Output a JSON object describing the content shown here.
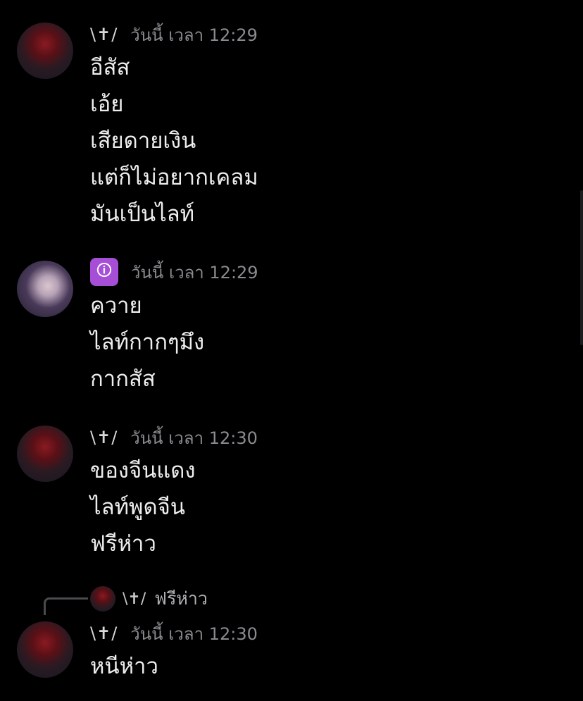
{
  "messages": [
    {
      "avatar": "red-masked-avatar",
      "name": "\\✝/",
      "timestamp": "วันนี้ เวลา 12:29",
      "lines": [
        "อีสัส",
        "เอ้ย",
        "เสียดายเงิน",
        "แต่ก็ไม่อยากเคลม",
        "มันเป็นไลท์"
      ]
    },
    {
      "avatar": "purple-hair-girl-avatar",
      "badge": "🛈",
      "timestamp": "วันนี้ เวลา 12:29",
      "lines": [
        "ควาย",
        "ไลท์กากๆมึง",
        "กากสัส"
      ]
    },
    {
      "avatar": "red-masked-avatar",
      "name": "\\✝/",
      "timestamp": "วันนี้ เวลา 12:30",
      "lines": [
        "ของจีนแดง",
        "ไลท์พูดจีน",
        "ฟรีห่าว"
      ]
    },
    {
      "avatar": "red-masked-avatar",
      "name": "\\✝/",
      "timestamp": "วันนี้ เวลา 12:30",
      "reply": {
        "name": "\\✝/",
        "text": "ฟรีห่าว"
      },
      "lines": [
        "หนีห่าว"
      ]
    }
  ],
  "colors": {
    "background": "#000000",
    "text": "#eeeeee",
    "timestamp": "#8a8a90",
    "badge": "#a64fd6"
  }
}
